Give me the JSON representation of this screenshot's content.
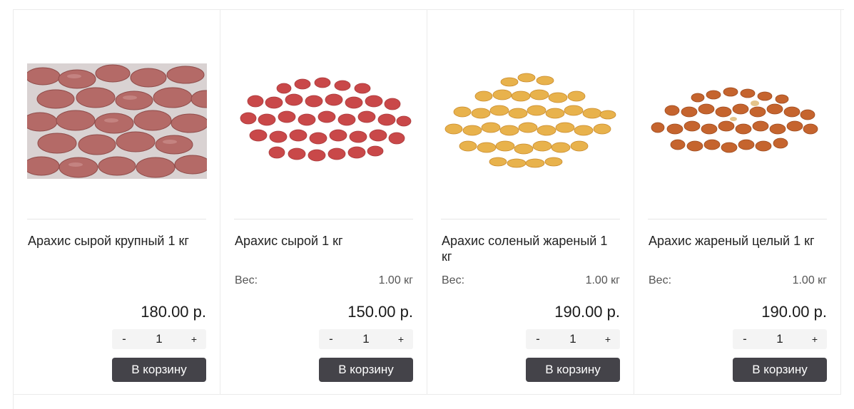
{
  "products": [
    {
      "title": "Арахис сырой крупный 1 кг",
      "weight_label": "",
      "weight_value": "",
      "price": "180.00 р.",
      "qty_minus": "-",
      "qty_value": "1",
      "qty_plus": "+",
      "cart_label": "В корзину",
      "image_icon": "raw-large-peanuts-photo"
    },
    {
      "title": "Арахис сырой 1 кг",
      "weight_label": "Вес:",
      "weight_value": "1.00 кг",
      "price": "150.00 р.",
      "qty_minus": "-",
      "qty_value": "1",
      "qty_plus": "+",
      "cart_label": "В корзину",
      "image_icon": "raw-peanuts-photo"
    },
    {
      "title": "Арахис соленый жареный 1 кг",
      "weight_label": "Вес:",
      "weight_value": "1.00 кг",
      "price": "190.00 р.",
      "qty_minus": "-",
      "qty_value": "1",
      "qty_plus": "+",
      "cart_label": "В корзину",
      "image_icon": "salted-roasted-peanuts-photo"
    },
    {
      "title": "Арахис жареный целый 1 кг",
      "weight_label": "Вес:",
      "weight_value": "1.00 кг",
      "price": "190.00 р.",
      "qty_minus": "-",
      "qty_value": "1",
      "qty_plus": "+",
      "cart_label": "В корзину",
      "image_icon": "whole-roasted-peanuts-photo"
    }
  ],
  "colors": {
    "cart_button": "#444349",
    "raw_peanut": "#b86b68",
    "raw_peanut_red": "#c9484a",
    "salted_peanut": "#e7b04a",
    "roasted_peanut": "#c5642e"
  }
}
